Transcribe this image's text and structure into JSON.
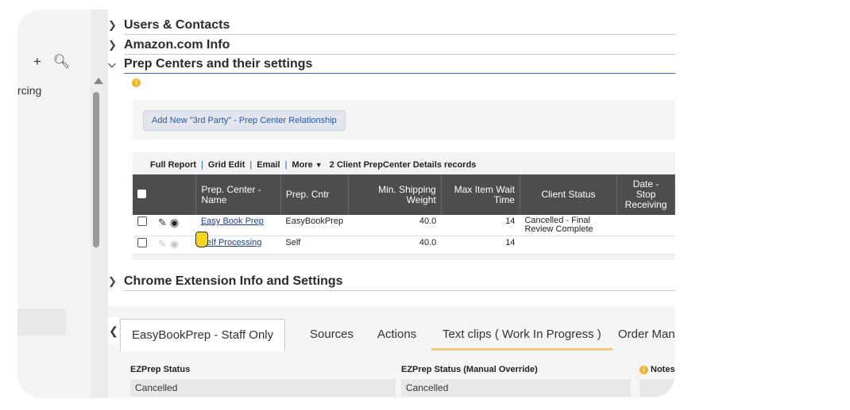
{
  "sidebar": {
    "add_icon": "plus-icon",
    "search_icon": "search-icon",
    "item_label": "rcing"
  },
  "sections": {
    "users": "Users & Contacts",
    "amazon": "Amazon.com Info",
    "prep": "Prep Centers and their settings",
    "chrome": "Chrome Extension Info and Settings"
  },
  "prep": {
    "info_icon": "info-icon",
    "add_button": "Add New \"3rd Party\" - Prep Center Relationship",
    "toolbar": {
      "full_report": "Full Report",
      "grid_edit": "Grid Edit",
      "email": "Email",
      "more": "More",
      "records": "2 Client PrepCenter Details records"
    },
    "columns": [
      "Prep. Center - Name",
      "Prep. Cntr",
      "Min. Shipping Weight",
      "Max Item Wait Time",
      "Client Status",
      "Date - Stop Receiving"
    ],
    "rows": [
      {
        "name": "Easy Book Prep",
        "cntr": "EasyBookPrep",
        "min_weight": "40.0",
        "max_wait": "14",
        "status": "Cancelled - Final Review Complete",
        "date": ""
      },
      {
        "name": "Self Processing",
        "cntr": "Self",
        "min_weight": "40.0",
        "max_wait": "14",
        "status": "",
        "date": ""
      }
    ]
  },
  "tabs": [
    "EasyBookPrep - Staff Only",
    "Sources",
    "Actions",
    "Text clips ( Work In Progress )",
    "Order Manage"
  ],
  "fields": {
    "ezprep_status_label": "EZPrep Status",
    "ezprep_status_value": "Cancelled",
    "ezprep_override_label": "EZPrep Status (Manual Override)",
    "ezprep_override_value": "Cancelled",
    "notes_label": "Notes"
  }
}
